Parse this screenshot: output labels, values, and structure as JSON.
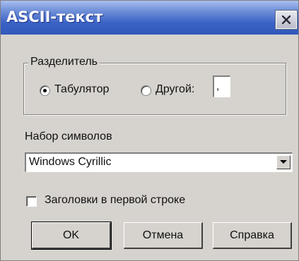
{
  "window": {
    "title": "ASCII-текст",
    "close_glyph": "✕"
  },
  "separator_group": {
    "label": "Разделитель",
    "tab_option": {
      "label": "Табулятор",
      "selected": true
    },
    "other_option": {
      "label": "Другой:",
      "selected": false,
      "value": ","
    }
  },
  "charset": {
    "label": "Набор символов",
    "selected": "Windows Cyrillic"
  },
  "headers_checkbox": {
    "label": "Заголовки в первой строке",
    "checked": false
  },
  "buttons": {
    "ok": "OK",
    "cancel": "Отмена",
    "help": "Справка"
  },
  "colors": {
    "title_bar": "#3b63c6",
    "face": "#d6d3ce"
  },
  "icons": {
    "close": "close-icon",
    "dropdown": "chevron-down-icon"
  }
}
